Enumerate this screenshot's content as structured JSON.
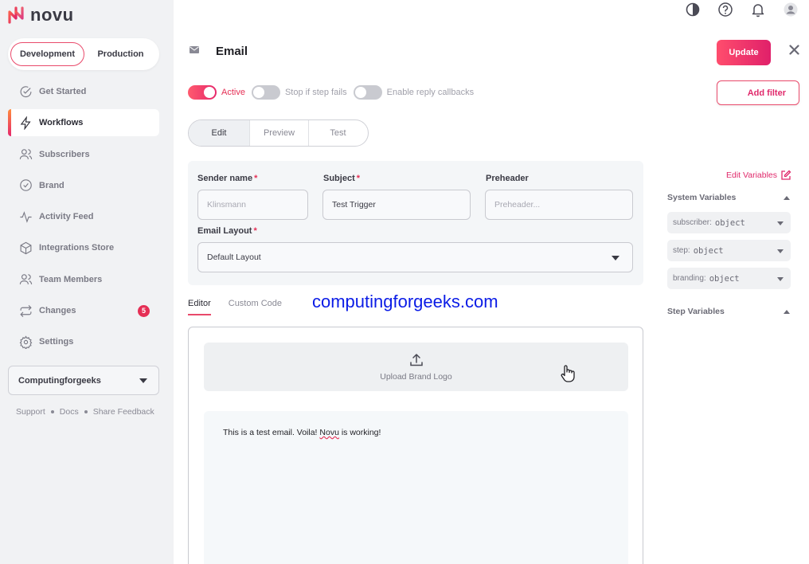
{
  "brand": {
    "name": "novu",
    "accent": "#e94a6b",
    "gradient_start": "#ff5a6e",
    "gradient_end": "#e0206a"
  },
  "env_switch": {
    "development": "Development",
    "production": "Production",
    "active": "development"
  },
  "sidebar": {
    "items": [
      {
        "label": "Get Started",
        "icon": "check-circle-icon"
      },
      {
        "label": "Workflows",
        "icon": "bolt-icon",
        "active": true
      },
      {
        "label": "Subscribers",
        "icon": "users-icon"
      },
      {
        "label": "Brand",
        "icon": "badge-check-icon"
      },
      {
        "label": "Activity Feed",
        "icon": "activity-icon"
      },
      {
        "label": "Integrations Store",
        "icon": "box-icon"
      },
      {
        "label": "Team Members",
        "icon": "team-icon"
      },
      {
        "label": "Changes",
        "icon": "repeat-icon",
        "badge": "5"
      },
      {
        "label": "Settings",
        "icon": "gear-icon"
      }
    ],
    "org": "Computingforgeeks",
    "footer": {
      "support": "Support",
      "docs": "Docs",
      "feedback": "Share Feedback"
    }
  },
  "header": {
    "title": "Email",
    "update": "Update",
    "add_filter": "Add filter"
  },
  "toggles": [
    {
      "label": "Active",
      "on": true
    },
    {
      "label": "Stop if step fails",
      "on": false
    },
    {
      "label": "Enable reply callbacks",
      "on": false
    }
  ],
  "tabs": {
    "edit": "Edit",
    "preview": "Preview",
    "test": "Test",
    "active": "edit"
  },
  "form": {
    "sender_name": {
      "label": "Sender name",
      "placeholder": "Klinsmann"
    },
    "subject": {
      "label": "Subject",
      "value": "Test Trigger"
    },
    "preheader": {
      "label": "Preheader",
      "placeholder": "Preheader..."
    },
    "email_layout": {
      "label": "Email Layout",
      "value": "Default Layout"
    },
    "required_mark": "*"
  },
  "editor_tabs": {
    "editor": "Editor",
    "custom_code": "Custom Code"
  },
  "watermark": "computingforgeeks.com",
  "editor": {
    "upload_label": "Upload Brand Logo",
    "body_before": "This is a test email. Voila! ",
    "body_spell": "Novu",
    "body_after": " is working!"
  },
  "variables": {
    "edit_label": "Edit Variables",
    "system_heading": "System Variables",
    "system": [
      {
        "name": "subscriber:",
        "type": "object"
      },
      {
        "name": "step:",
        "type": "object"
      },
      {
        "name": "branding:",
        "type": "object"
      }
    ],
    "step_heading": "Step Variables"
  }
}
